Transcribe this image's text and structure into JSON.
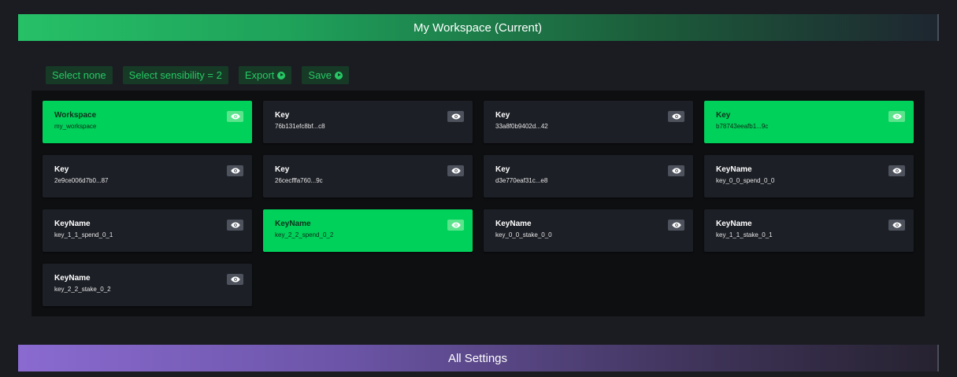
{
  "header": {
    "title": "My Workspace (Current)"
  },
  "toolbar": {
    "select_none": "Select none",
    "select_sensibility": "Select sensibility = 2",
    "export": "Export",
    "save": "Save"
  },
  "cards": [
    {
      "title": "Workspace",
      "value": "my_workspace",
      "selected": true
    },
    {
      "title": "Key",
      "value": "76b131efc8bf...c8",
      "selected": false
    },
    {
      "title": "Key",
      "value": "33a8f0b9402d...42",
      "selected": false
    },
    {
      "title": "Key",
      "value": "b78743eeafb1...9c",
      "selected": true
    },
    {
      "title": "Key",
      "value": "2e9ce006d7b0...87",
      "selected": false
    },
    {
      "title": "Key",
      "value": "26cecfffa760...9c",
      "selected": false
    },
    {
      "title": "Key",
      "value": "d3e770eaf31c...e8",
      "selected": false
    },
    {
      "title": "KeyName",
      "value": "key_0_0_spend_0_0",
      "selected": false
    },
    {
      "title": "KeyName",
      "value": "key_1_1_spend_0_1",
      "selected": false
    },
    {
      "title": "KeyName",
      "value": "key_2_2_spend_0_2",
      "selected": true
    },
    {
      "title": "KeyName",
      "value": "key_0_0_stake_0_0",
      "selected": false
    },
    {
      "title": "KeyName",
      "value": "key_1_1_stake_0_1",
      "selected": false
    },
    {
      "title": "KeyName",
      "value": "key_2_2_stake_0_2",
      "selected": false
    }
  ],
  "footer": {
    "title": "All Settings"
  },
  "icons": {
    "toggle": "eye-icon",
    "action": "play-circle-icon"
  },
  "colors": {
    "selected": "#00d15a",
    "button_text": "#25c965",
    "button_bg": "#173a26",
    "card_bg": "#1c1f26"
  }
}
